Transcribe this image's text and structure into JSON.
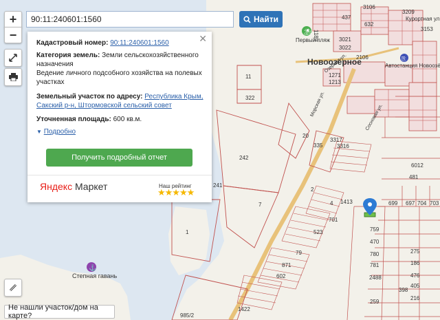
{
  "search": {
    "value": "90:11:240601:1560",
    "button_label": "Найти"
  },
  "controls": {
    "zoom_in": "+",
    "zoom_out": "−"
  },
  "popup": {
    "cadastral_label": "Кадастровый номер:",
    "cadastral_value": "90:11:240601:1560",
    "category_label": "Категория земель:",
    "category_value": "Земли сельскохозяйственного назначения",
    "use_value": "Ведение личного подсобного хозяйства на полевых участках",
    "address_label": "Земельный участок по адресу:",
    "address_value": "Республика Крым, Сакский р-н, Штормовской сельский совет",
    "area_label": "Уточненная площадь:",
    "area_value": "600 кв.м.",
    "more": "Подробно",
    "report_button": "Получить подробный отчет",
    "market_ya": "Яндекс",
    "market_name": "Маркет",
    "rating_label": "Наш рейтинг",
    "stars": "★★★★★"
  },
  "map": {
    "place_labels": {
      "town": "Новоозёрное",
      "beach": "Первый пляж",
      "bus": "Автостанция Новоозёрное",
      "street1": "Курортная ул.",
      "street2": "Морская ул.",
      "street3": "Сосновая ул.",
      "street4": "Озерная ул.",
      "harbor": "Степная гавань"
    },
    "parcels": [
      "3209",
      "3153",
      "3106",
      "437",
      "632",
      "1189",
      "3021",
      "3022",
      "2106",
      "1271",
      "1213",
      "11",
      "322",
      "242",
      "241",
      "7",
      "1",
      "20",
      "3317",
      "3316",
      "335",
      "6012",
      "481",
      "699",
      "697",
      "704",
      "703",
      "2",
      "4",
      "701",
      "523",
      "1413",
      "79",
      "871",
      "602",
      "759",
      "470",
      "780",
      "781",
      "2488",
      "398",
      "259",
      "275",
      "186",
      "476",
      "405",
      "216",
      "1422",
      "985/2",
      "11"
    ]
  },
  "not_found": "Не нашли участок/дом на карте?"
}
